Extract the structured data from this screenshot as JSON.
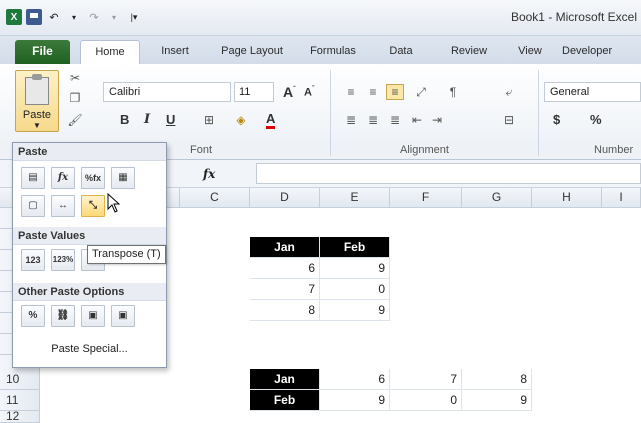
{
  "window": {
    "title": "Book1 - Microsoft Excel"
  },
  "tabs": [
    "File",
    "Home",
    "Insert",
    "Page Layout",
    "Formulas",
    "Data",
    "Review",
    "View",
    "Developer"
  ],
  "ribbon": {
    "paste_label": "Paste",
    "font_name": "Calibri",
    "font_size": "11",
    "number_format": "General",
    "group_font": "Font",
    "group_alignment": "Alignment",
    "group_number": "Number",
    "currency_symbol": "$",
    "percent_symbol": "%"
  },
  "formula_bar": {
    "fx": "fx"
  },
  "columns": [
    "C",
    "D",
    "E",
    "F",
    "G",
    "H",
    "I"
  ],
  "rows": [
    "10",
    "11",
    "12"
  ],
  "cells": {
    "d_jan": "Jan",
    "e_feb": "Feb",
    "d6": "6",
    "e6": "9",
    "d7": "7",
    "e7": "0",
    "d8": "8",
    "e8": "9",
    "r10_d": "Jan",
    "r10_e": "6",
    "r10_f": "7",
    "r10_g": "8",
    "r11_d": "Feb",
    "r11_e": "9",
    "r11_f": "0",
    "r11_g": "9"
  },
  "paste_gallery": {
    "header_paste": "Paste",
    "header_values": "Paste Values",
    "header_other": "Other Paste Options",
    "paste_special": "Paste Special...",
    "tooltip": "Transpose (T)",
    "icons": {
      "formulas": "fx",
      "formulas_number": "%fx",
      "values": "123",
      "values_number": "123%"
    }
  }
}
